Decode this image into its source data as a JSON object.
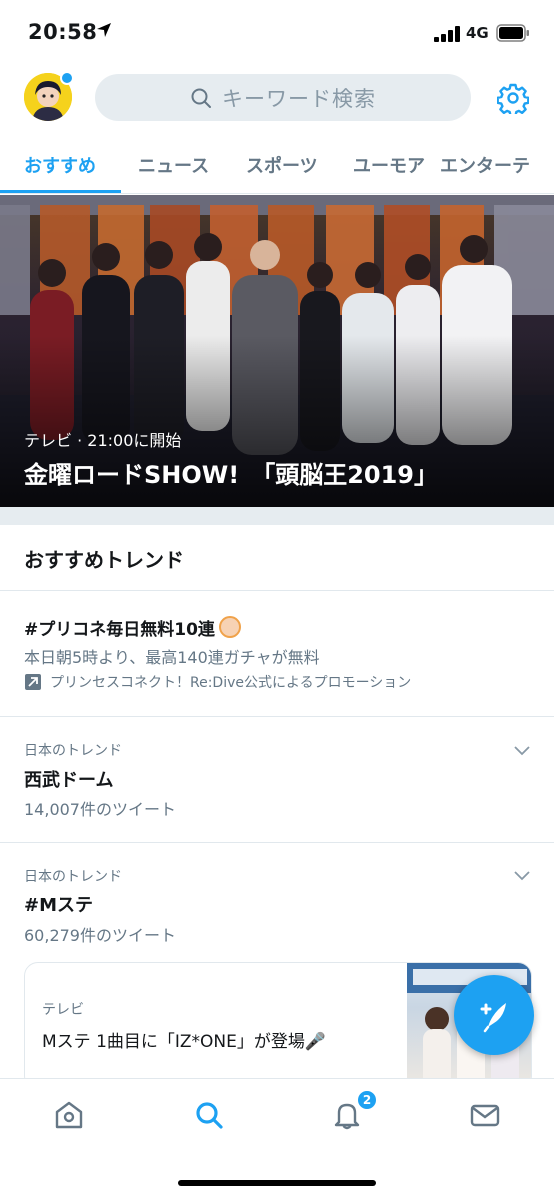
{
  "status_bar": {
    "time": "20:58",
    "network": "4G",
    "icons": [
      "location-arrow-icon",
      "signal-icon",
      "battery-icon"
    ]
  },
  "header": {
    "search_placeholder": "キーワード検索",
    "icons": [
      "avatar",
      "search-icon",
      "gear-icon"
    ]
  },
  "tabs": [
    {
      "label": "おすすめ",
      "active": true
    },
    {
      "label": "ニュース",
      "active": false
    },
    {
      "label": "スポーツ",
      "active": false
    },
    {
      "label": "ユーモア",
      "active": false
    },
    {
      "label": "エンターテ",
      "active": false
    }
  ],
  "hero": {
    "meta": "テレビ · 21:00に開始",
    "title": "金曜ロードSHOW!　「頭脳王2019」"
  },
  "trends_section": {
    "title": "おすすめトレンド",
    "promoted": {
      "hashtag": "#プリコネ毎日無料10連",
      "description": "本日朝5時より、最高140連ガチャが無料",
      "promotion": "プリンセスコネクト！Re:Dive公式によるプロモーション"
    },
    "items": [
      {
        "context": "日本のトレンド",
        "name": "西武ドーム",
        "count": "14,007件のツイート"
      },
      {
        "context": "日本のトレンド",
        "name": "#Mステ",
        "count": "60,279件のツイート"
      }
    ],
    "news_card": {
      "label": "テレビ",
      "text": "Mステ 1曲目に「IZ*ONE」が登場🎤"
    }
  },
  "bottom_nav": {
    "items": [
      "home-icon",
      "search-icon",
      "bell-icon",
      "mail-icon"
    ],
    "notification_badge": "2"
  },
  "colors": {
    "accent": "#1da1f2",
    "text_primary": "#14171a",
    "text_secondary": "#657786",
    "divider": "#e1e8ed"
  }
}
